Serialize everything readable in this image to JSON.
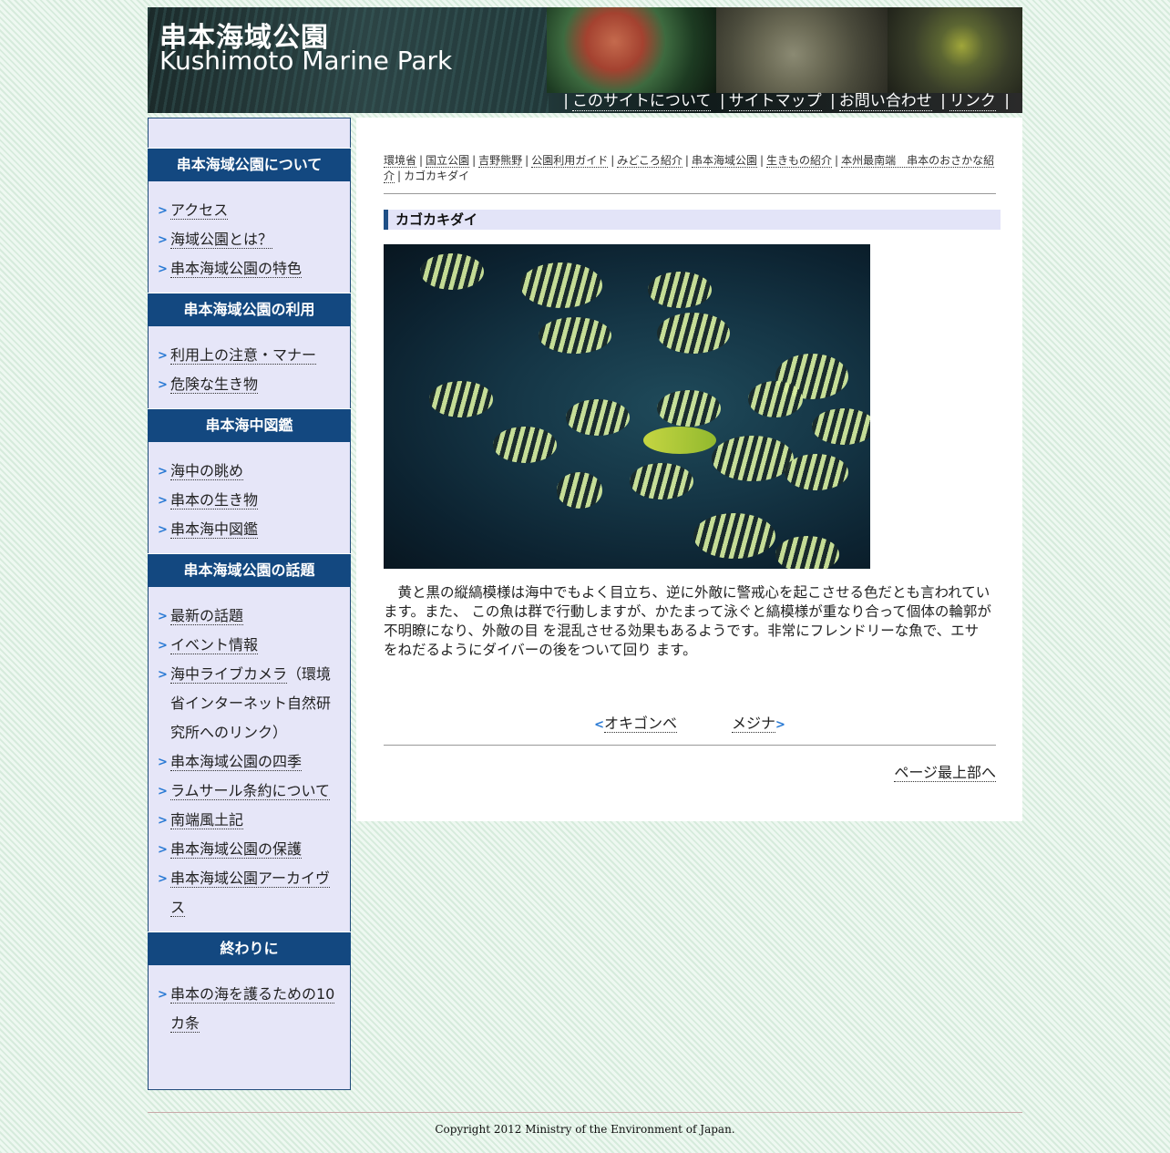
{
  "header": {
    "title_ja": "串本海域公園",
    "title_en": "Kushimoto Marine Park",
    "nav": [
      "このサイトについて",
      "サイトマップ",
      "お問い合わせ",
      "リンク"
    ]
  },
  "sidebar": {
    "sections": [
      {
        "title": "串本海域公園について",
        "items": [
          "アクセス",
          "海域公園とは？",
          "串本海域公園の特色"
        ]
      },
      {
        "title": "串本海域公園の利用",
        "items": [
          "利用上の注意・マナー",
          "危険な生き物"
        ]
      },
      {
        "title": "串本海中図鑑",
        "items": [
          "海中の眺め",
          "串本の生き物",
          "串本海中図鑑"
        ]
      },
      {
        "title": "串本海域公園の話題",
        "items": [
          "最新の話題",
          "イベント情報",
          "海中ライブカメラ",
          "串本海域公園の四季",
          "ラムサール条約について",
          "南端風土記",
          "串本海域公園の保護",
          "串本海域公園アーカイヴス"
        ],
        "livecam_note": "（環境省インターネット自然研究所へのリンク）"
      },
      {
        "title": "終わりに",
        "items": [
          "串本の海を護るための10カ条"
        ]
      }
    ]
  },
  "breadcrumb": [
    "環境省",
    "国立公園",
    "吉野熊野",
    "公園利用ガイド",
    "みどころ紹介",
    "串本海域公園",
    "生きもの紹介",
    "本州最南端　串本のおさかな紹介",
    "カゴカキダイ"
  ],
  "main": {
    "title": "カゴカキダイ",
    "description": "黄と黒の縦縞模様は海中でもよく目立ち、逆に外敵に警戒心を起こさせる色だとも言われています。また、 この魚は群で行動しますが、かたまって泳ぐと縞模様が重なり合って個体の輪郭が不明瞭になり、外敵の目 を混乱させる効果もあるようです。非常にフレンドリーな魚で、エサをねだるようにダイバーの後をついて回り ます。",
    "prev": "オキゴンベ",
    "next": "メジナ",
    "pagetop": "ページ最上部へ"
  },
  "footer": {
    "copyright": "Copyright 2012 Ministry of the Environment of Japan."
  },
  "colors": {
    "sidebar_head": "#134880",
    "sidebar_bg": "#e6e6f8",
    "arrow": "#2a7ad4"
  }
}
